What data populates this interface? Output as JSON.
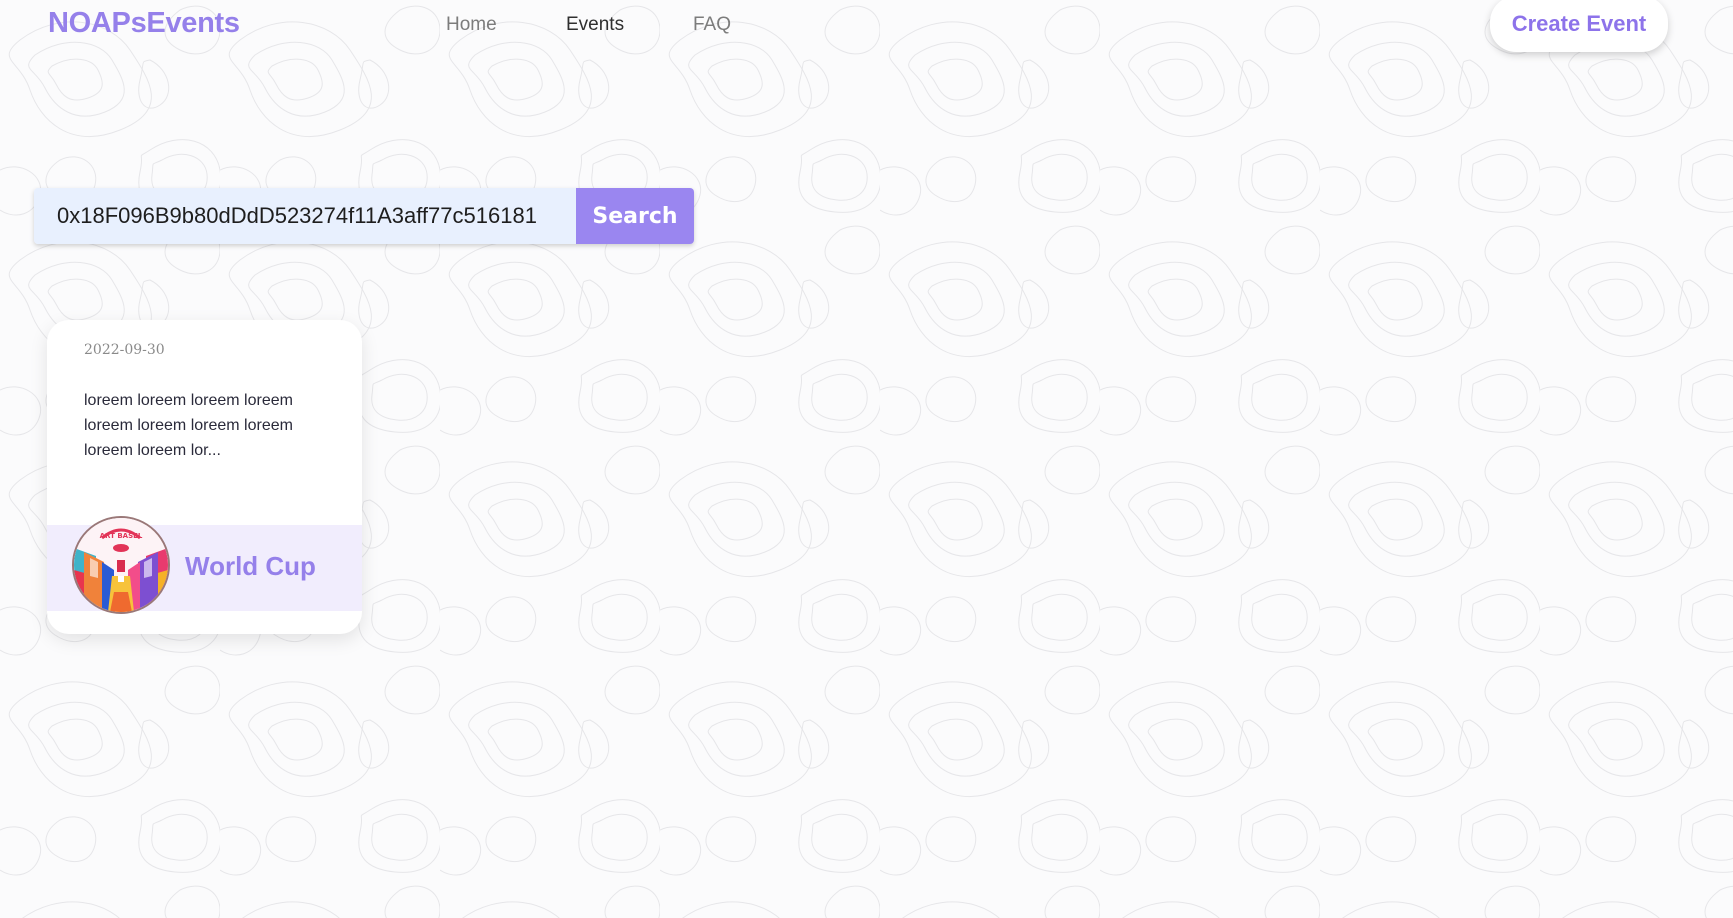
{
  "header": {
    "logo": "NOAPsEvents",
    "nav": [
      {
        "label": "Home",
        "active": false
      },
      {
        "label": "Events",
        "active": true
      },
      {
        "label": "FAQ",
        "active": false
      }
    ],
    "create_button": "Create Event"
  },
  "search": {
    "value": "0x18F096B9b80dDdD523274f11A3aff77c516181",
    "button_label": "Search"
  },
  "events": [
    {
      "date": "2022-09-30",
      "description": "loreem loreem loreem loreem loreem loreem loreem loreem loreem loreem lor...",
      "title": "World Cup",
      "image_icon": "art-basel-logo",
      "image_text": "ART BASEL"
    }
  ],
  "colors": {
    "accent": "#9580ea",
    "search_button": "#9a86f0",
    "search_input_bg": "#e8f0fe",
    "card_footer_bg": "#f1edfd"
  }
}
